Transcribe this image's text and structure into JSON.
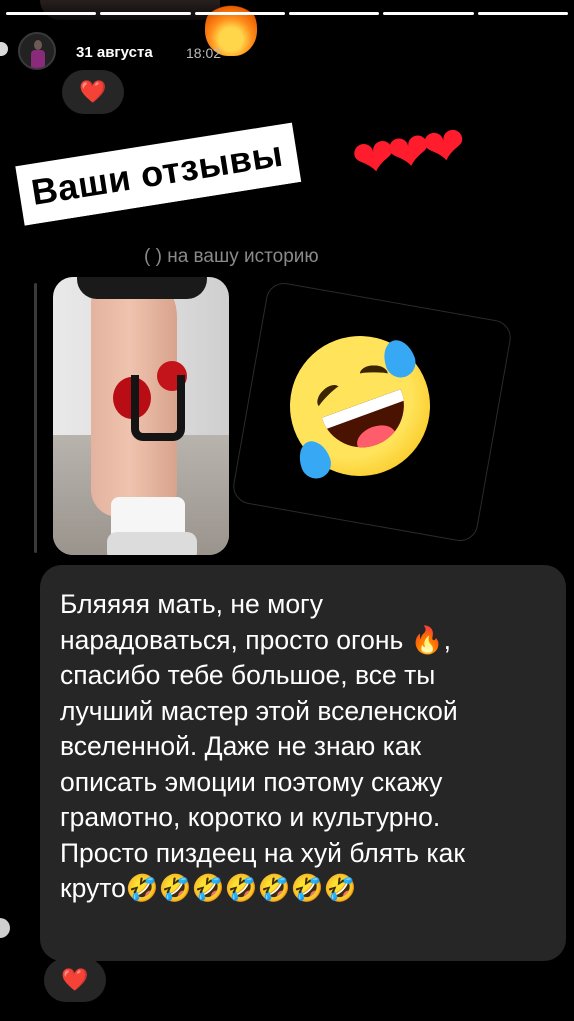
{
  "story": {
    "progress_segments": 6,
    "active_segments": 6
  },
  "header": {
    "date": "31 августа",
    "time": "18:02"
  },
  "reactions": {
    "top": "❤️",
    "bottom": "❤️"
  },
  "sticker": {
    "title": "Ваши отзывы",
    "hearts": "❤❤❤"
  },
  "reply": {
    "context_text": "( ) на вашу историю"
  },
  "message": {
    "text": "Бляяяя мать, не могу\nнарадоваться, просто огонь 🔥,\nспасибо тебе большое, все ты\nлучший мастер этой вселенской\nвселенной. Даже не знаю как\nописать эмоции поэтому скажу\nграмотно, коротко и культурно.\nПросто пиздеец на хуй блять как\nкруто🤣🤣🤣🤣🤣🤣🤣"
  },
  "colors": {
    "bubble": "#262626",
    "heart": "#ff2b4a",
    "background": "#000000"
  }
}
